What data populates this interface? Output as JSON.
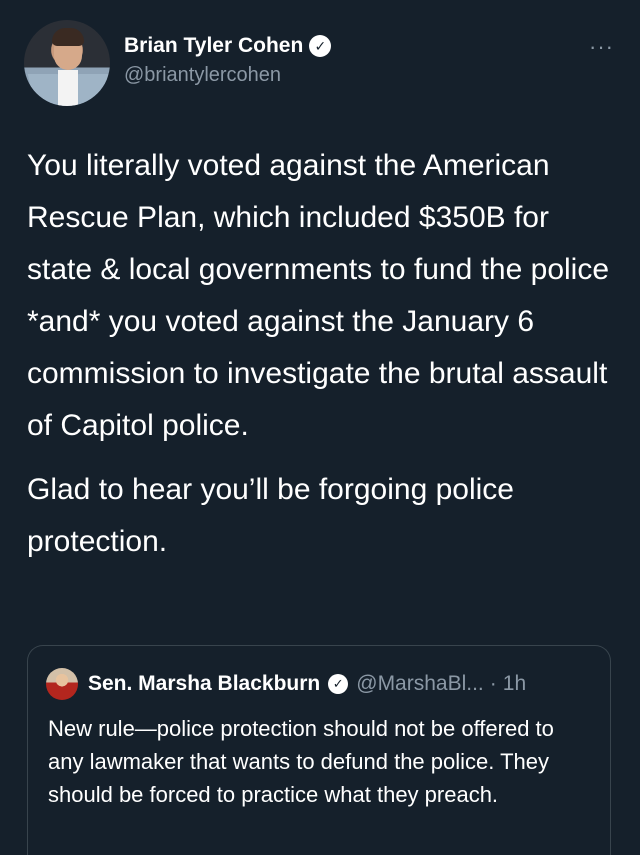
{
  "author": {
    "display_name": "Brian Tyler Cohen",
    "handle": "@briantylercohen",
    "verified_glyph": "✓"
  },
  "more_glyph": "···",
  "tweet": {
    "paragraph_1": "You literally voted against the American Rescue Plan, which included $350B for state & local governments to fund the police *and* you voted against the January 6 commission to investigate the brutal assault of Capitol police.",
    "paragraph_2": "Glad to hear you’ll be forgoing police protection."
  },
  "quoted_tweet": {
    "display_name": "Sen. Marsha Blackburn",
    "verified_glyph": "✓",
    "handle": "@MarshaBl...",
    "separator": "·",
    "time": "1h",
    "text": "New rule—police protection should not be offered to any lawmaker that wants to defund the police. They should be forced to practice what they preach."
  },
  "colors": {
    "background": "#15202b",
    "secondary_text": "#8b98a5",
    "border": "#38444d"
  },
  "icons": {
    "verified": "verified-badge-icon",
    "more": "more-options-icon"
  }
}
